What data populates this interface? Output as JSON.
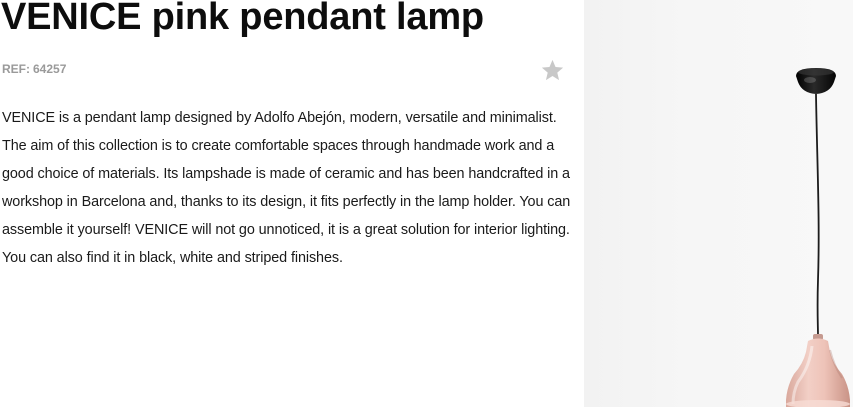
{
  "product": {
    "title": "VENICE pink pendant lamp",
    "ref_label": "REF:",
    "ref_value": "64257",
    "description": "VENICE is a pendant lamp designed by Adolfo Abejón, modern, versatile and minimalist. The aim of this collection is to create comfortable spaces through handmade work and a good choice of materials. Its lampshade is made of ceramic and has been handcrafted in a workshop in Barcelona and, thanks to its design, it fits perfectly in the lamp holder. You can assemble it yourself! VENICE will not go unnoticed, it is a great solution for interior lighting. You can also find it in black, white and striped finishes."
  },
  "icons": {
    "favorite": "star-icon"
  },
  "colors": {
    "title": "#0d0d0d",
    "ref": "#9a9a9a",
    "star": "#c8c8c8",
    "image_background": "#f5f5f5",
    "canopy": "#111111",
    "lampshade": "#e8bdb2"
  }
}
